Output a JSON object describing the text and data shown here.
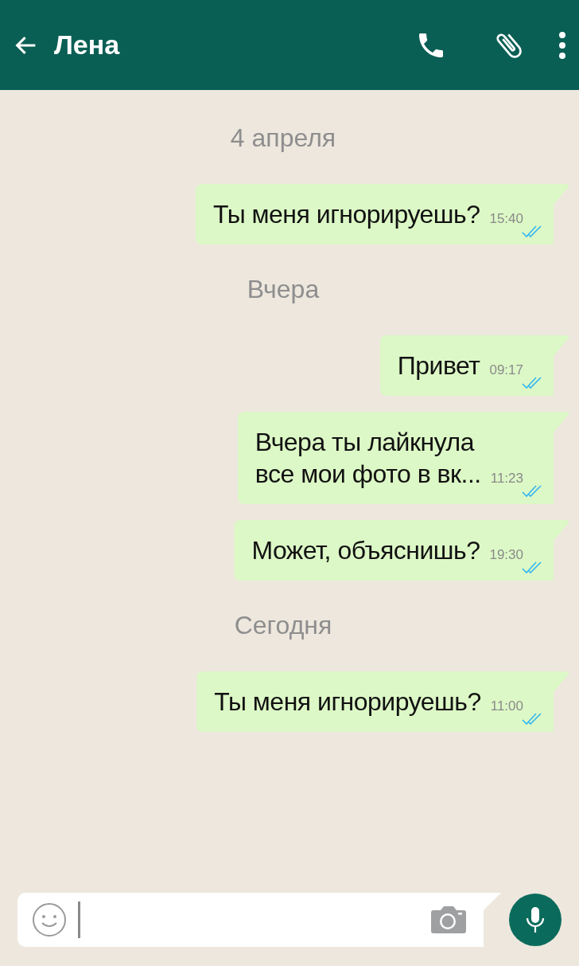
{
  "header": {
    "title": "Лена"
  },
  "chat": [
    {
      "kind": "date",
      "text": "4 апреля"
    },
    {
      "kind": "message",
      "text": "Ты меня игнорируешь?",
      "time": "15:40",
      "read": true
    },
    {
      "kind": "date",
      "text": "Вчера"
    },
    {
      "kind": "message",
      "text": "Привет",
      "time": "09:17",
      "read": true
    },
    {
      "kind": "message",
      "text": "Вчера ты лайкнула\nвсе мои фото в вк...",
      "time": "11:23",
      "read": true
    },
    {
      "kind": "message",
      "text": "Может, объяснишь?",
      "time": "19:30",
      "read": true
    },
    {
      "kind": "date",
      "text": "Сегодня"
    },
    {
      "kind": "message",
      "text": "Ты меня игнорируешь?",
      "time": "11:00",
      "read": true
    }
  ]
}
